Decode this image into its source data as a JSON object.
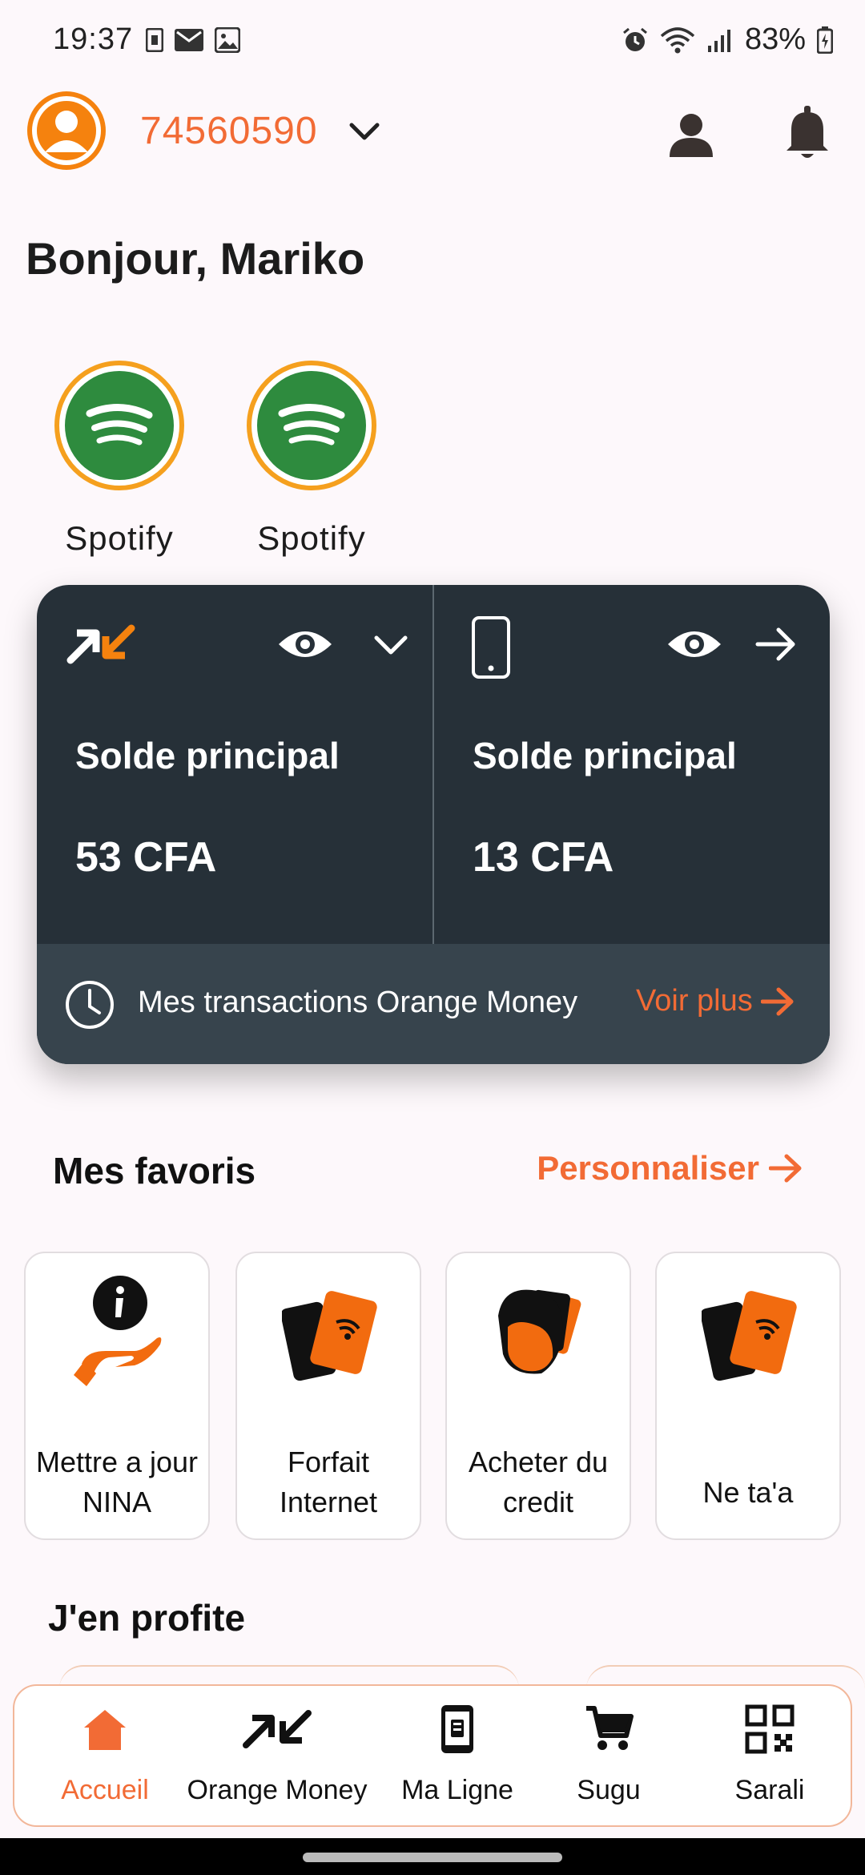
{
  "status_bar": {
    "time": "19:37",
    "battery": "83%"
  },
  "header": {
    "phone_number": "74560590"
  },
  "greeting": "Bonjour, Mariko",
  "stories": [
    {
      "label": "Spotify"
    },
    {
      "label": "Spotify"
    }
  ],
  "balances": {
    "left": {
      "label": "Solde principal",
      "value": "53 CFA"
    },
    "right": {
      "label": "Solde principal",
      "value": "13 CFA"
    },
    "footer_text": "Mes transactions Orange Money",
    "voir_plus": "Voir plus"
  },
  "favoris": {
    "title": "Mes favoris",
    "customize": "Personnaliser",
    "items": [
      {
        "label": "Mettre a jour NINA"
      },
      {
        "label": "Forfait Internet"
      },
      {
        "label": "Acheter du credit"
      },
      {
        "label": "Ne ta'a"
      }
    ]
  },
  "profite": {
    "title": "J'en profite"
  },
  "nav": {
    "items": [
      {
        "label": "Accueil"
      },
      {
        "label": "Orange Money"
      },
      {
        "label": "Ma Ligne"
      },
      {
        "label": "Sugu"
      },
      {
        "label": "Sarali"
      }
    ]
  },
  "colors": {
    "accent": "#f26b35",
    "card": "#263038",
    "card_footer": "#37444d",
    "story_ring": "#f5a01e",
    "spotify": "#2e8b3e"
  }
}
